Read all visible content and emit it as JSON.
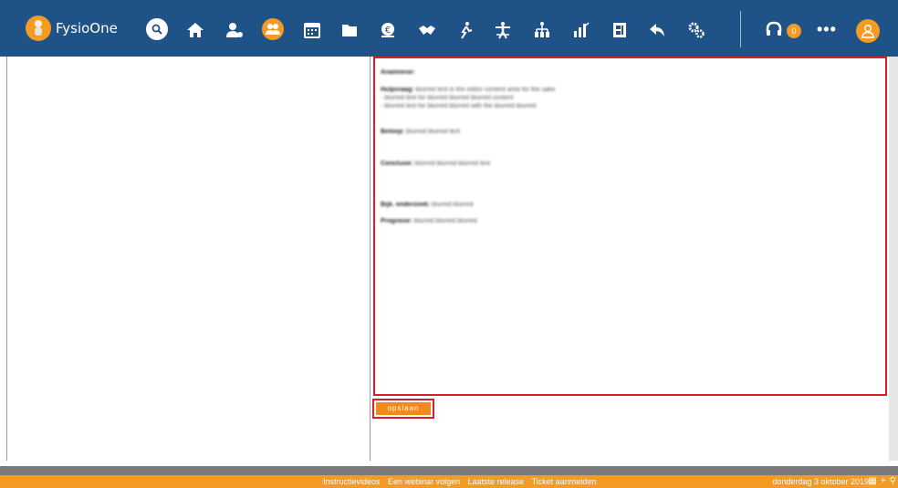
{
  "app": {
    "name": "FysioOne"
  },
  "nav": {
    "icons": [
      "search-icon",
      "home-icon",
      "user-add-icon",
      "group-icon",
      "calendar-icon",
      "folder-icon",
      "billing-icon",
      "handshake-icon",
      "runner-icon",
      "exercise-icon",
      "hierarchy-icon",
      "stats-icon",
      "report-icon",
      "back-arrow-icon",
      "settings-icon"
    ],
    "notification_count": "0",
    "more": "•••"
  },
  "colors": {
    "topbar": "#1f5387",
    "accent": "#f59a23",
    "highlight": "#d91e2a"
  },
  "editor": {
    "lines": [
      {
        "bold": "Anamnese:",
        "text": ""
      },
      {
        "bold": "Hulpvraag:",
        "text": " blurred text in the editor content area for the sake"
      },
      {
        "bold": "",
        "text": "- blurred text for blurred blurred blurred content"
      },
      {
        "bold": "",
        "text": "- blurred text for blurred blurred with the blurred blurred"
      },
      {
        "bold": "Beloop:",
        "text": " blurred blurred text"
      },
      {
        "bold": "Conclusie:",
        "text": " blurred blurred blurred text"
      },
      {
        "bold": "Bijk. onderzoek:",
        "text": " blurred blurred"
      },
      {
        "bold": "Prognose:",
        "text": " blurred blurred blurred"
      }
    ]
  },
  "actions": {
    "save_label": "opslaan"
  },
  "footer": {
    "links": [
      "Instructievideos",
      "Een webinar volgen",
      "Laatste release",
      "Ticket aanmelden"
    ],
    "date": "donderdag 3 oktober 2019"
  }
}
